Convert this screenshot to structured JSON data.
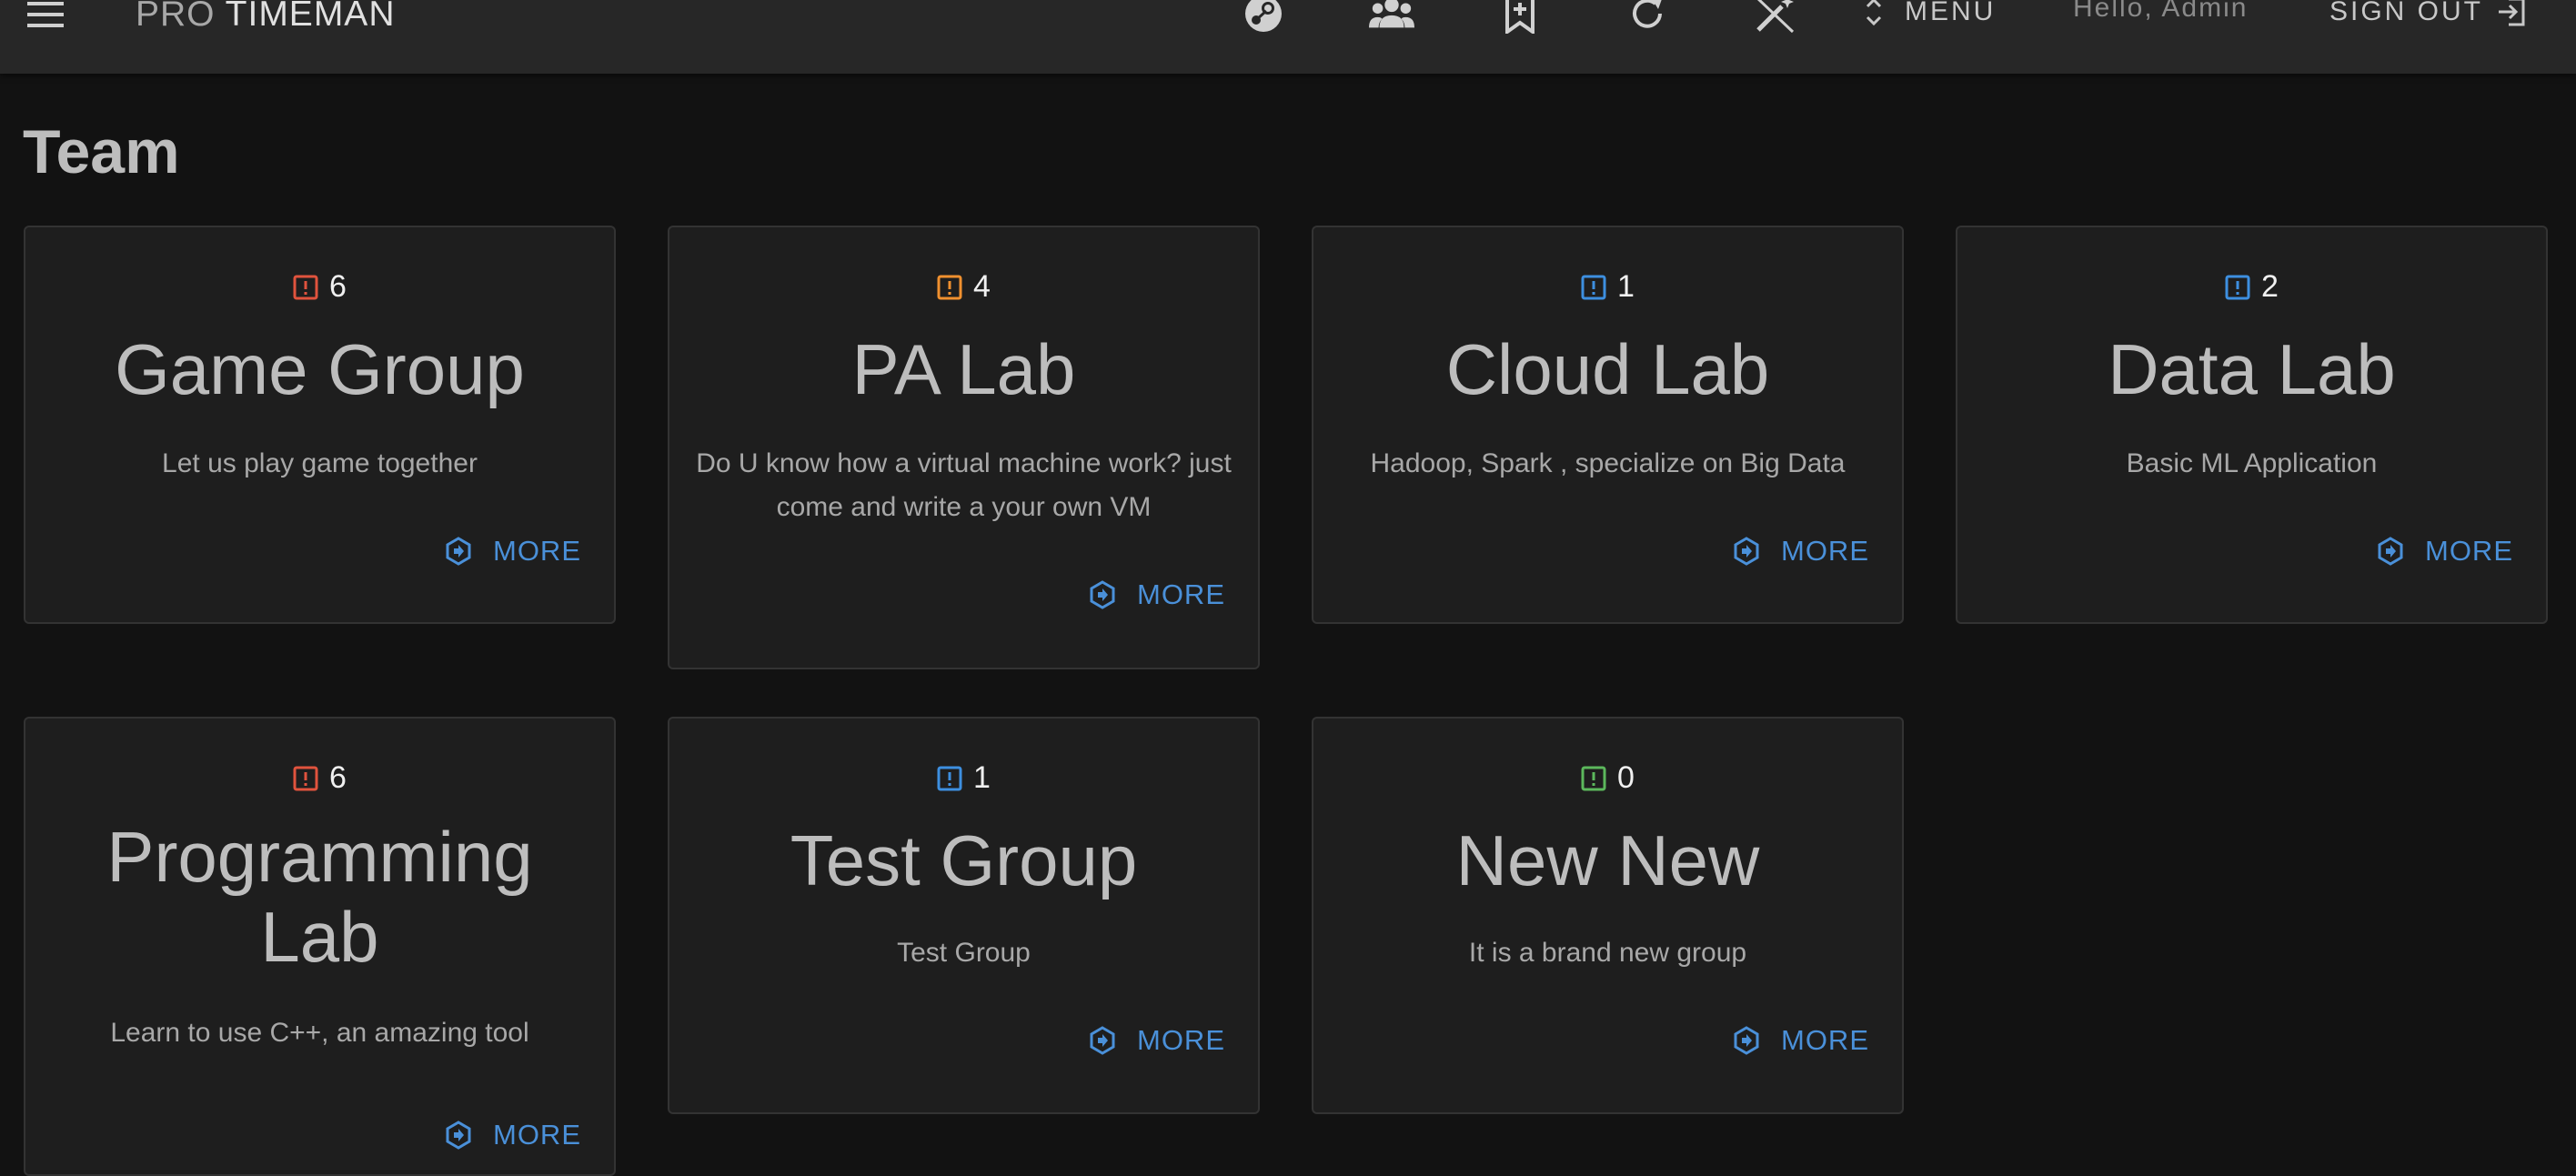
{
  "app": {
    "brand_light": "PRO",
    "brand_bold": "TIMEMAN"
  },
  "header": {
    "icons": [
      "steam-icon",
      "group-icon",
      "bookmark-add-icon",
      "refresh-icon",
      "magic-wand-off-icon"
    ],
    "menu_label": "MENU",
    "greeting": "Hello, Admin",
    "signout_label": "SIGN OUT"
  },
  "page": {
    "title": "Team"
  },
  "teams": [
    {
      "count": "6",
      "status_color": "#e0533d",
      "name": "Game Group",
      "description": "Let us play game together",
      "more_label": "MORE"
    },
    {
      "count": "4",
      "status_color": "#f0902f",
      "name": "PA Lab",
      "description": "Do U know how a virtual machine work? just come and write a your own VM",
      "more_label": "MORE"
    },
    {
      "count": "1",
      "status_color": "#3d8fe0",
      "name": "Cloud Lab",
      "description": "Hadoop, Spark , specialize on Big Data",
      "more_label": "MORE"
    },
    {
      "count": "2",
      "status_color": "#3d8fe0",
      "name": "Data Lab",
      "description": "Basic ML Application",
      "more_label": "MORE"
    },
    {
      "count": "6",
      "status_color": "#e0533d",
      "name": "Programming Lab",
      "description": "Learn to use C++, an amazing tool",
      "more_label": "MORE"
    },
    {
      "count": "1",
      "status_color": "#3d8fe0",
      "name": "Test Group",
      "description": "Test Group",
      "more_label": "MORE"
    },
    {
      "count": "0",
      "status_color": "#5cb85c",
      "name": "New New",
      "description": "It is a brand new group",
      "more_label": "MORE"
    }
  ],
  "colors": {
    "accent": "#4a90d9",
    "background": "#121212",
    "card": "#1e1e1e",
    "appbar": "#272727"
  }
}
